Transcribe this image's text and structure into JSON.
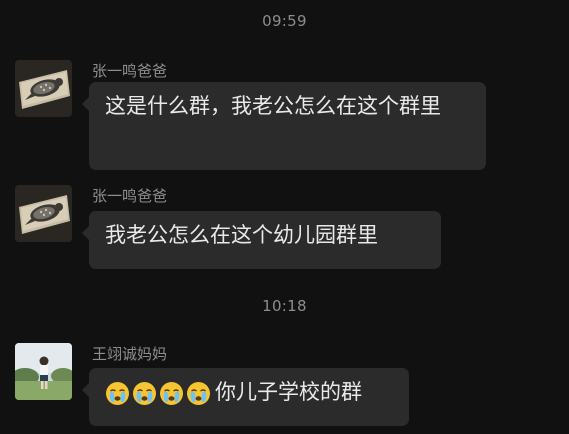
{
  "chat": {
    "time1": "09:59",
    "time2": "10:18",
    "messages": [
      {
        "sender": "张一鸣爸爸",
        "text": "这是什么群，我老公怎么在这个群里",
        "avatar": "bird-avatar"
      },
      {
        "sender": "张一鸣爸爸",
        "text": "我老公怎么在这个幼儿园群里",
        "avatar": "bird-avatar"
      },
      {
        "sender": "王翊诚妈妈",
        "text": "你儿子学校的群",
        "avatar": "child-photo-avatar",
        "emoji": "crying-face-emoji",
        "emoji_count": 4
      }
    ]
  }
}
